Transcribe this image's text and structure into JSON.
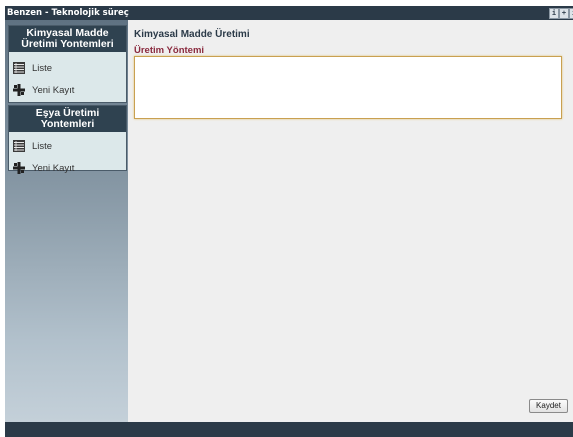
{
  "window": {
    "title": "Benzen - Teknolojik süreç",
    "buttons": [
      "i",
      "+",
      "i"
    ]
  },
  "sidebar": {
    "sections": [
      {
        "header": "Kimyasal Madde Üretimi Yontemleri",
        "items": [
          {
            "label": "Liste",
            "icon": "list-icon"
          },
          {
            "label": "Yeni Kayıt",
            "icon": "new-record-icon"
          }
        ]
      },
      {
        "header": "Eşya Üretimi Yontemleri",
        "items": [
          {
            "label": "Liste",
            "icon": "list-icon"
          },
          {
            "label": "Yeni Kayıt",
            "icon": "new-record-icon"
          }
        ]
      }
    ]
  },
  "form": {
    "title": "Kimyasal Madde Üretimi",
    "field_label": "Üretim Yöntemi",
    "field_value": "",
    "save_label": "Kaydet"
  },
  "colors": {
    "titlebar": "#2b3a48",
    "field_label": "#8a2a3e",
    "input_border": "#c9a050",
    "main_bg": "#efefef"
  }
}
